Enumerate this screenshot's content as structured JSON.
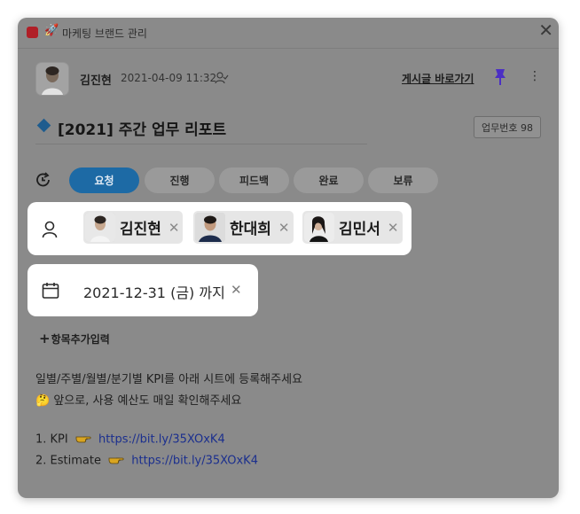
{
  "window": {
    "app_title": "마케팅 브랜드 관리"
  },
  "post": {
    "author": "김진현",
    "date": "2021-04-09 11:32",
    "goto_link": "게시글 바로가기",
    "title": "[2021] 주간 업무 리포트",
    "task_number": "업무번호 98"
  },
  "status": {
    "options": [
      "요청",
      "진행",
      "피드백",
      "완료",
      "보류"
    ],
    "selected": "요청"
  },
  "assignees": [
    {
      "name": "김진현"
    },
    {
      "name": "한대희"
    },
    {
      "name": "김민서"
    }
  ],
  "due": {
    "label": "2021-12-31 (금) 까지"
  },
  "add_field": {
    "label": "항목추가입력"
  },
  "content": {
    "line1": "일별/주별/월별/분기별 KPI를 아래 시트에 등록해주세요",
    "line2": "앞으로, 사용 예산도 매일 확인해주세요",
    "item1_prefix": "1. KPI",
    "item1_link": "https://bit.ly/35XOxK4",
    "item2_prefix": "2. Estimate",
    "item2_link": "https://bit.ly/35XOxK4"
  },
  "colors": {
    "app_icon": "#b01f27",
    "active_status": "#1d6aa5",
    "pin": "#4b2fc4",
    "link": "#1b2f8e",
    "title_diamond": "#1e5c8e"
  },
  "icons": [
    "app-icon",
    "rocket-icon",
    "close-icon",
    "viewer-icon",
    "pin-icon",
    "more-icon",
    "status-change-icon",
    "person-icon",
    "calendar-icon",
    "remove-icon",
    "thinking-emoji-icon",
    "pointing-hand-icon"
  ]
}
